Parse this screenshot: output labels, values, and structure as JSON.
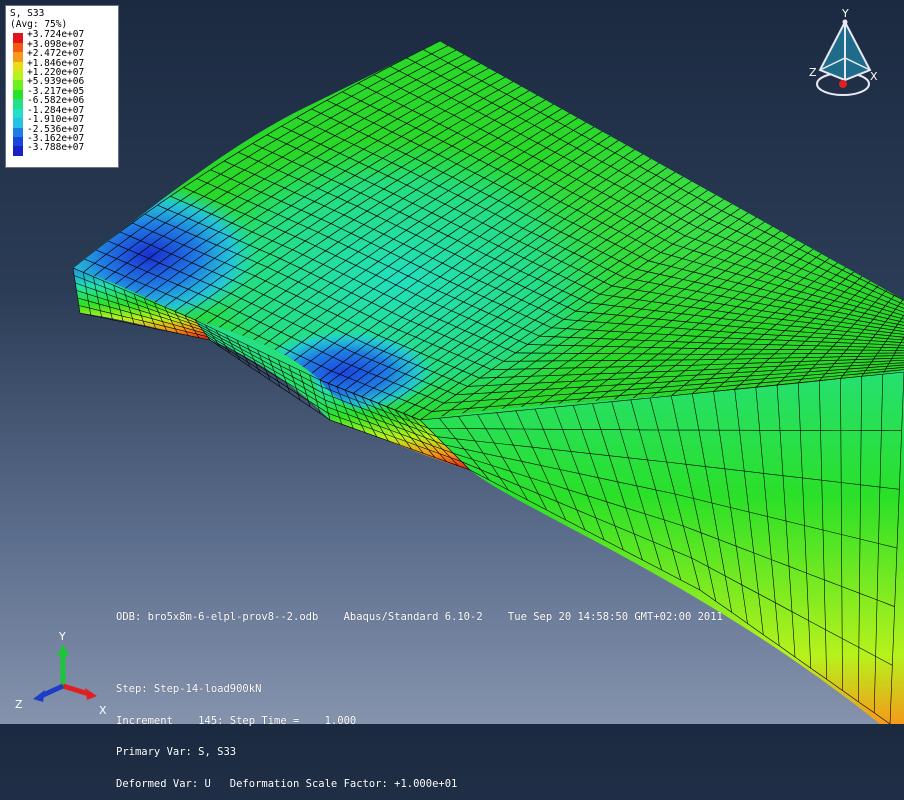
{
  "legend": {
    "title": "S, S33",
    "subtitle": "(Avg: 75%)",
    "entries": [
      {
        "value": "+3.724e+07",
        "color": "#e0141a"
      },
      {
        "value": "+3.098e+07",
        "color": "#f25a12"
      },
      {
        "value": "+2.472e+07",
        "color": "#f59a1a"
      },
      {
        "value": "+1.846e+07",
        "color": "#e8de16"
      },
      {
        "value": "+1.220e+07",
        "color": "#b6f21c"
      },
      {
        "value": "+5.939e+06",
        "color": "#6ef01e"
      },
      {
        "value": "-3.217e+05",
        "color": "#2ae028"
      },
      {
        "value": "-6.582e+06",
        "color": "#22e08a"
      },
      {
        "value": "-1.284e+07",
        "color": "#22e0c8"
      },
      {
        "value": "-1.910e+07",
        "color": "#23c2e6"
      },
      {
        "value": "-2.536e+07",
        "color": "#1f7ee4"
      },
      {
        "value": "-3.162e+07",
        "color": "#1b45dd"
      },
      {
        "value": "-3.788e+07",
        "color": "#1a20c8"
      }
    ]
  },
  "info": {
    "odb": "ODB: bro5x8m-6-elpl-prov8--2.odb    Abaqus/Standard 6.10-2    Tue Sep 20 14:58:50 GMT+02:00 2011",
    "step": "Step: Step-14-load900kN",
    "increment": "Increment    145: Step Time =    1.000",
    "primary_var": "Primary Var: S, S33",
    "deformed_var": "Deformed Var: U   Deformation Scale Factor: +1.000e+01"
  },
  "triad": {
    "x_label": "X",
    "y_label": "Y",
    "z_label": "Z"
  },
  "view_cube": {
    "x_label": "X",
    "y_label": "Y",
    "z_label": "Z"
  },
  "colors": {
    "mesh_top": "#2ad82a",
    "mesh_edge": "#000000",
    "background_top": "#1b2a40",
    "background_bottom": "#8593ad"
  }
}
